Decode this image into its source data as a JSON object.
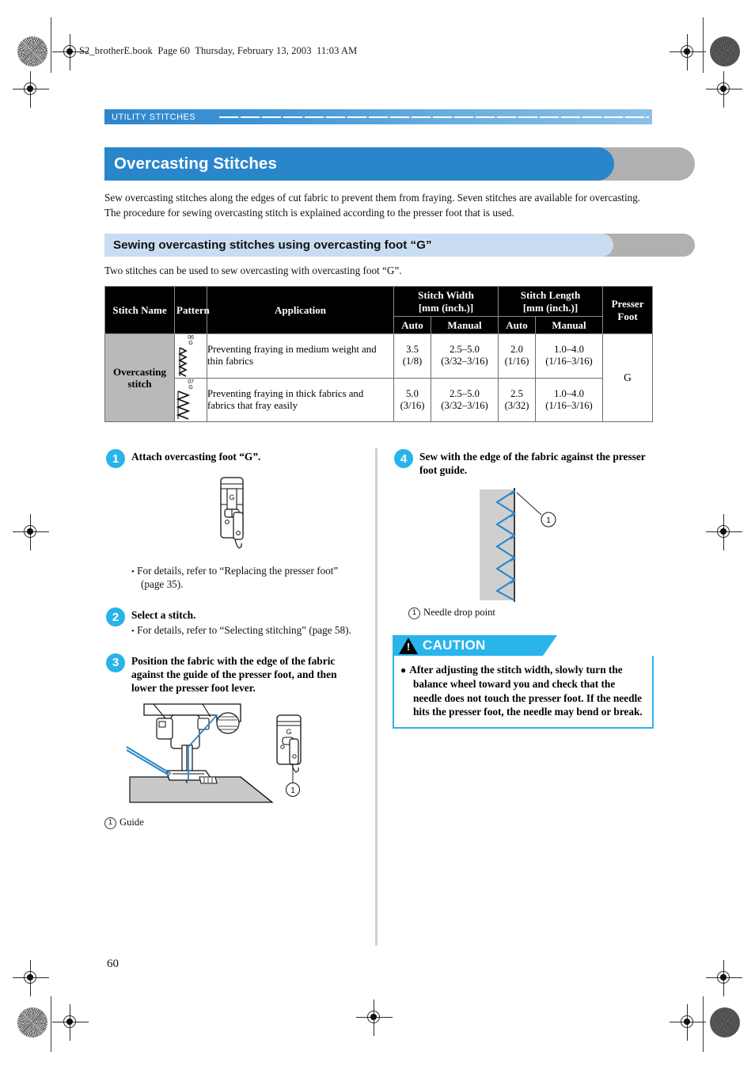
{
  "document": {
    "file_header": "S2_brotherE.book  Page 60  Thursday, February 13, 2003  11:03 AM",
    "running_head": "UTILITY STITCHES",
    "page_number": "60"
  },
  "section": {
    "title": "Overcasting Stitches",
    "intro": "Sew overcasting stitches along the edges of cut fabric to prevent them from fraying. Seven stitches are available for overcasting. The procedure for sewing overcasting stitch is explained according to the presser foot that is used.",
    "accent_color": "#2a86cb"
  },
  "subsection": {
    "title": "Sewing overcasting stitches using overcasting foot “G”",
    "intro": "Two stitches can be used to sew overcasting with overcasting foot “G”.",
    "accent_color": "#c9ddf2"
  },
  "table": {
    "headers": {
      "stitch_name": "Stitch Name",
      "pattern": "Pattern",
      "application": "Application",
      "stitch_width": "Stitch Width\n[mm (inch.)]",
      "stitch_width_line1": "Stitch Width",
      "stitch_width_line2": "[mm (inch.)]",
      "stitch_length_line1": "Stitch Length",
      "stitch_length_line2": "[mm (inch.)]",
      "presser_foot_line1": "Presser",
      "presser_foot_line2": "Foot",
      "auto": "Auto",
      "manual": "Manual"
    },
    "stitch_name": "Overcasting stitch",
    "stitch_name_line1": "Overcasting",
    "stitch_name_line2": "stitch",
    "presser_foot": "G",
    "rows": [
      {
        "pattern_number": "06",
        "pattern_letter": "G",
        "application": "Preventing fraying in medium weight and thin fabrics",
        "width_auto_mm": "3.5",
        "width_auto_inch": "(1/8)",
        "width_manual_mm": "2.5–5.0",
        "width_manual_inch": "(3/32–3/16)",
        "length_auto_mm": "2.0",
        "length_auto_inch": "(1/16)",
        "length_manual_mm": "1.0–4.0",
        "length_manual_inch": "(1/16–3/16)"
      },
      {
        "pattern_number": "07",
        "pattern_letter": "G",
        "application": "Preventing fraying in thick fabrics and fabrics that fray easily",
        "width_auto_mm": "5.0",
        "width_auto_inch": "(3/16)",
        "width_manual_mm": "2.5–5.0",
        "width_manual_inch": "(3/32–3/16)",
        "length_auto_mm": "2.5",
        "length_auto_inch": "(3/32)",
        "length_manual_mm": "1.0–4.0",
        "length_manual_inch": "(1/16–3/16)"
      }
    ]
  },
  "steps": {
    "step1": {
      "number": "1",
      "heading": "Attach overcasting foot “G”.",
      "bullet": "For details, refer to “Replacing the presser foot” (page 35).",
      "foot_label": "G"
    },
    "step2": {
      "number": "2",
      "heading": "Select a stitch.",
      "bullet": "For details, refer to “Selecting stitching” (page 58)."
    },
    "step3": {
      "number": "3",
      "heading": "Position the fabric with the edge of the fabric against the guide of the presser foot, and then lower the presser foot lever.",
      "callout_number": "1",
      "caption": "Guide",
      "foot_label": "G"
    },
    "step4": {
      "number": "4",
      "heading": "Sew with the edge of the fabric against the presser foot guide.",
      "callout_number": "1",
      "caption": "Needle drop point"
    }
  },
  "caution": {
    "label": "CAUTION",
    "icon": "warning-triangle",
    "accent_color": "#29b4ec",
    "items": [
      "After adjusting the stitch width, slowly turn the balance wheel toward you and check that the needle does not touch the presser foot. If the needle hits the presser foot, the needle may bend or break."
    ]
  }
}
